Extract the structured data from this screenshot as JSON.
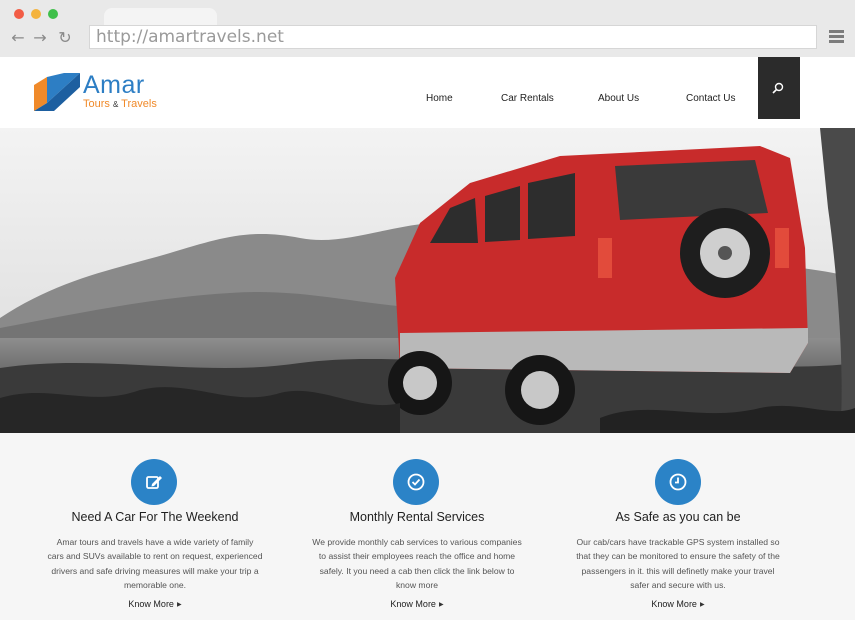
{
  "browser": {
    "url": "http://amartravels.net",
    "back_icon": "←",
    "forward_icon": "→",
    "reload_icon": "↻"
  },
  "site": {
    "logo_name": "Amar",
    "logo_tag_left": "Tours",
    "logo_tag_amp": "&",
    "logo_tag_right": "Travels",
    "brand_colors": {
      "blue": "#2d7ec4",
      "orange": "#f08a2a"
    }
  },
  "nav": {
    "items": [
      {
        "label": "Home"
      },
      {
        "label": "Car Rentals"
      },
      {
        "label": "About Us"
      },
      {
        "label": "Contact Us"
      }
    ],
    "search_icon": "search-icon"
  },
  "features": [
    {
      "icon": "edit-icon",
      "title": "Need A Car For The Weekend",
      "lines": [
        "Amar tours and travels have a wide variety of family",
        "cars and SUVs available to rent on request, experienced",
        "drivers and safe driving measures will make your trip a",
        "memorable one."
      ],
      "link": "Know More"
    },
    {
      "icon": "check-circle-icon",
      "title": "Monthly Rental Services",
      "lines": [
        "We provide monthly cab services to various companies",
        "to assist their employees reach the office and home",
        "safely. It you need a cab then click the link below to",
        "know more"
      ],
      "link": "Know More"
    },
    {
      "icon": "clock-icon",
      "title": "As Safe as you can be",
      "lines": [
        "Our cab/cars have trackable GPS system installed so",
        "that they can be monitored to ensure the safety of the",
        "passengers in it. this will definetly make your travel",
        "safer and secure with us."
      ],
      "link": "Know More"
    }
  ]
}
